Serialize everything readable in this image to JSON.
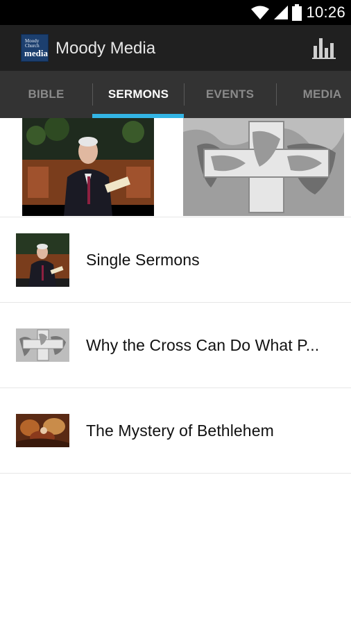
{
  "status_bar": {
    "time": "10:26",
    "icons": [
      "wifi-icon",
      "signal-icon",
      "battery-icon"
    ]
  },
  "app_bar": {
    "title": "Moody Media",
    "logo_lines": [
      "Moody",
      "Church",
      "media"
    ],
    "action_icon": "bar-chart-icon"
  },
  "tabs": [
    {
      "label": "BIBLE",
      "active": false
    },
    {
      "label": "SERMONS",
      "active": true
    },
    {
      "label": "EVENTS",
      "active": false
    },
    {
      "label": "MEDIA",
      "active": false
    }
  ],
  "list": [
    {
      "title": "Single Sermons",
      "thumb": "preacher-thumbnail"
    },
    {
      "title": "Why the Cross Can Do What P...",
      "thumb": "cross-map-thumbnail"
    },
    {
      "title": "The Mystery of Bethlehem",
      "thumb": "nativity-thumbnail"
    }
  ],
  "colors": {
    "accent": "#33b5e5",
    "action_bar": "#202020",
    "tab_bar": "#333333",
    "status_bar": "#000000"
  }
}
